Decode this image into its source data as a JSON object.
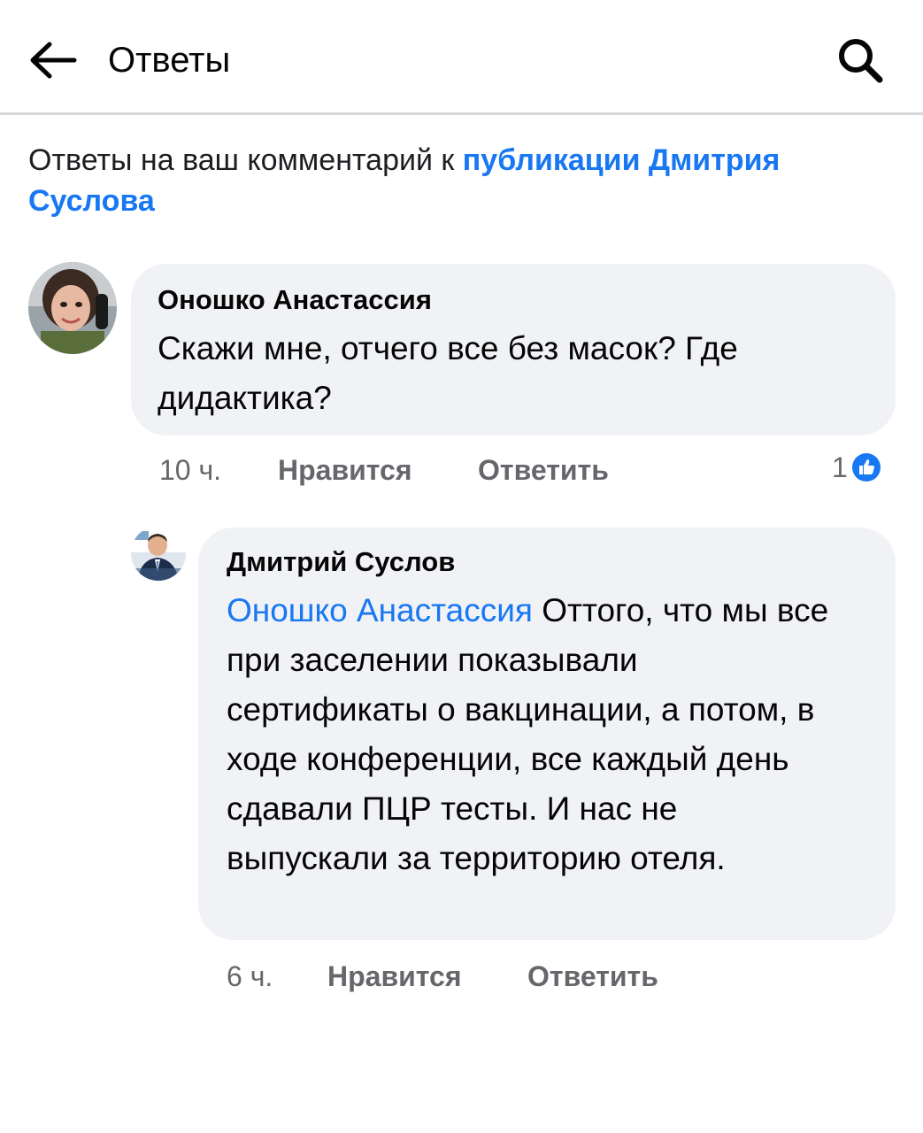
{
  "header": {
    "title": "Ответы",
    "back_icon": "arrow-left-icon",
    "search_icon": "search-icon"
  },
  "intro": {
    "text": "Ответы на ваш комментарий к ",
    "link": "публикации Дмитрия Суслова"
  },
  "comments": [
    {
      "author": "Оношко Анастассия",
      "text": "Скажи мне, отчего все без масок? Где дидактика?",
      "time": "10 ч.",
      "like_label": "Нравится",
      "reply_label": "Ответить",
      "reaction_count": "1",
      "reaction_icon": "like-icon"
    },
    {
      "author": "Дмитрий Суслов",
      "mention": "Оношко Анастассия",
      "text": " Оттого, что мы все при заселении показывали сертификаты о вакцинации, а потом, в ходе конференции, все каждый день сдавали ПЦР тесты. И нас не выпускали за территорию отеля.",
      "time": "6 ч.",
      "like_label": "Нравится",
      "reply_label": "Ответить"
    }
  ],
  "colors": {
    "link": "#1877f2",
    "bubble": "#f0f2f5",
    "meta": "#65676b",
    "divider": "#d4d6da"
  }
}
